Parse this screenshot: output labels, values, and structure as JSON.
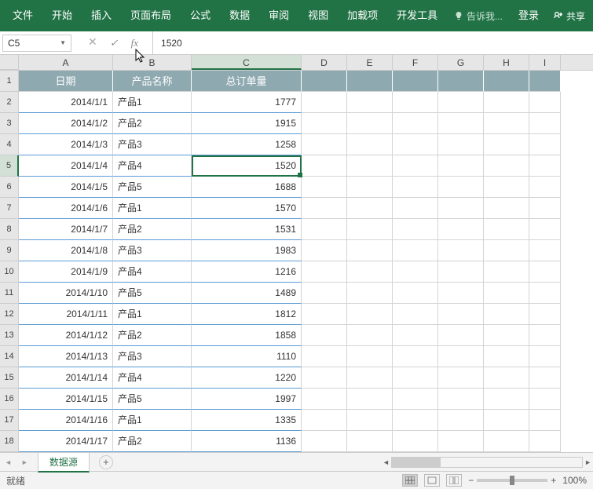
{
  "ribbon": {
    "tabs": [
      "文件",
      "开始",
      "插入",
      "页面布局",
      "公式",
      "数据",
      "审阅",
      "视图",
      "加载项",
      "开发工具"
    ],
    "tell": "告诉我...",
    "login": "登录",
    "share": "共享"
  },
  "fbar": {
    "name": "C5",
    "formula": "1520"
  },
  "cols": [
    "A",
    "B",
    "C",
    "D",
    "E",
    "F",
    "G",
    "H",
    "I"
  ],
  "selected_col_idx": 2,
  "selected_row": 5,
  "headers": [
    "日期",
    "产品名称",
    "总订单量"
  ],
  "rows": [
    {
      "n": 1
    },
    {
      "n": 2,
      "a": "2014/1/1",
      "b": "产品1",
      "c": "1777"
    },
    {
      "n": 3,
      "a": "2014/1/2",
      "b": "产品2",
      "c": "1915"
    },
    {
      "n": 4,
      "a": "2014/1/3",
      "b": "产品3",
      "c": "1258"
    },
    {
      "n": 5,
      "a": "2014/1/4",
      "b": "产品4",
      "c": "1520"
    },
    {
      "n": 6,
      "a": "2014/1/5",
      "b": "产品5",
      "c": "1688"
    },
    {
      "n": 7,
      "a": "2014/1/6",
      "b": "产品1",
      "c": "1570"
    },
    {
      "n": 8,
      "a": "2014/1/7",
      "b": "产品2",
      "c": "1531"
    },
    {
      "n": 9,
      "a": "2014/1/8",
      "b": "产品3",
      "c": "1983"
    },
    {
      "n": 10,
      "a": "2014/1/9",
      "b": "产品4",
      "c": "1216"
    },
    {
      "n": 11,
      "a": "2014/1/10",
      "b": "产品5",
      "c": "1489"
    },
    {
      "n": 12,
      "a": "2014/1/11",
      "b": "产品1",
      "c": "1812"
    },
    {
      "n": 13,
      "a": "2014/1/12",
      "b": "产品2",
      "c": "1858"
    },
    {
      "n": 14,
      "a": "2014/1/13",
      "b": "产品3",
      "c": "1110"
    },
    {
      "n": 15,
      "a": "2014/1/14",
      "b": "产品4",
      "c": "1220"
    },
    {
      "n": 16,
      "a": "2014/1/15",
      "b": "产品5",
      "c": "1997"
    },
    {
      "n": 17,
      "a": "2014/1/16",
      "b": "产品1",
      "c": "1335"
    },
    {
      "n": 18,
      "a": "2014/1/17",
      "b": "产品2",
      "c": "1136"
    }
  ],
  "sheet": "数据源",
  "status": {
    "ready": "就绪",
    "zoom": "100%"
  }
}
